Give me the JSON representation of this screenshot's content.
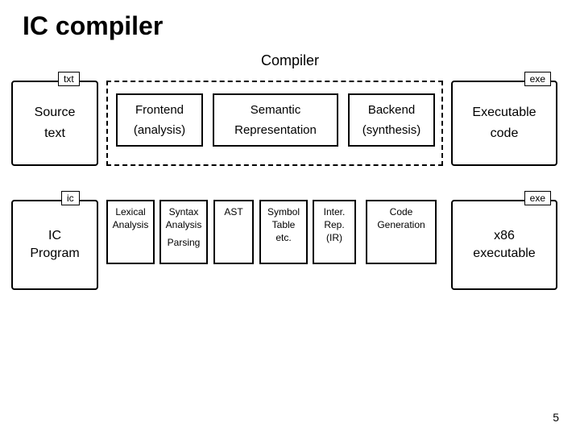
{
  "title": "IC compiler",
  "subtitle": "Compiler",
  "pagenum": "5",
  "hl": {
    "src_tag": "txt",
    "src_l1": "Source",
    "src_l2": "text",
    "exe_tag": "exe",
    "exe_l1": "Executable",
    "exe_l2": "code",
    "fe_l1": "Frontend",
    "fe_l2": "(analysis)",
    "sm_l1": "Semantic",
    "sm_l2": "Representation",
    "be_l1": "Backend",
    "be_l2": "(synthesis)"
  },
  "det": {
    "ic_tag": "ic",
    "ic_l1": "IC",
    "ic_l2": "Program",
    "exe_tag": "exe",
    "x86_l1": "x86",
    "x86_l2": "executable",
    "lex_l1": "Lexical",
    "lex_l2": "Analysis",
    "syn_l1": "Syntax",
    "syn_l2": "Analysis",
    "syn_l3": "Parsing",
    "ast": "AST",
    "sym_l1": "Symbol",
    "sym_l2": "Table",
    "sym_l3": "etc.",
    "ir_l1": "Inter.",
    "ir_l2": "Rep.",
    "ir_l3": "(IR)",
    "cg_l1": "Code",
    "cg_l2": "Generation"
  }
}
